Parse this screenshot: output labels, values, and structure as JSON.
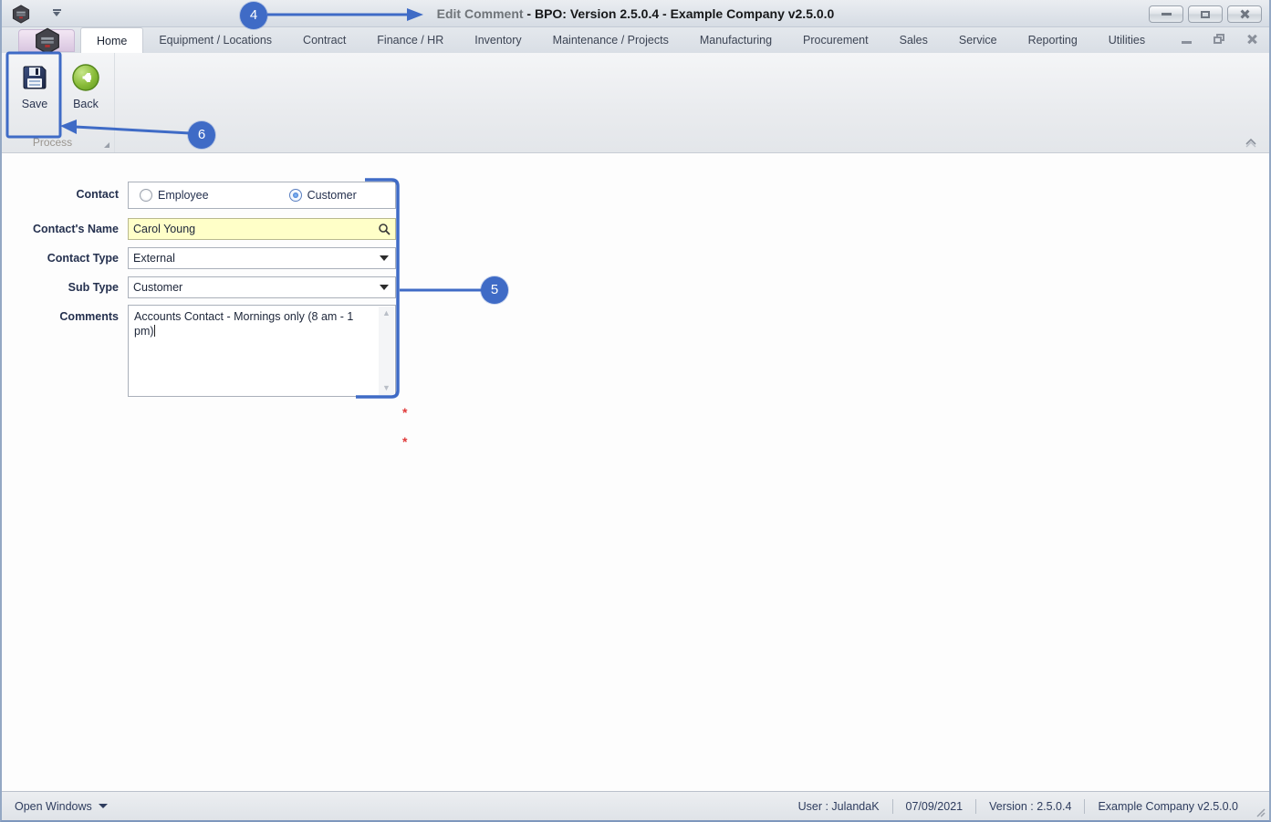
{
  "titlebar": {
    "title_prefix": "Edit Comment ",
    "title_main": "- BPO: Version 2.5.0.4 - Example Company v2.5.0.0"
  },
  "ribbon": {
    "tabs": [
      {
        "label": "Home",
        "selected": true
      },
      {
        "label": "Equipment / Locations",
        "selected": false
      },
      {
        "label": "Contract",
        "selected": false
      },
      {
        "label": "Finance / HR",
        "selected": false
      },
      {
        "label": "Inventory",
        "selected": false
      },
      {
        "label": "Maintenance / Projects",
        "selected": false
      },
      {
        "label": "Manufacturing",
        "selected": false
      },
      {
        "label": "Procurement",
        "selected": false
      },
      {
        "label": "Sales",
        "selected": false
      },
      {
        "label": "Service",
        "selected": false
      },
      {
        "label": "Reporting",
        "selected": false
      },
      {
        "label": "Utilities",
        "selected": false
      }
    ],
    "save_label": "Save",
    "back_label": "Back",
    "group_label": "Process"
  },
  "form": {
    "contact": {
      "label": "Contact",
      "options": [
        {
          "label": "Employee",
          "selected": false
        },
        {
          "label": "Customer",
          "selected": true
        }
      ]
    },
    "contacts_name": {
      "label": "Contact's Name",
      "value": "Carol Young"
    },
    "contact_type": {
      "label": "Contact Type",
      "value": "External",
      "required_marker": "*"
    },
    "sub_type": {
      "label": "Sub Type",
      "value": "Customer",
      "required_marker": "*"
    },
    "comments": {
      "label": "Comments",
      "value": "Accounts Contact - Mornings only (8 am - 1 pm)"
    }
  },
  "annotations": {
    "callout_4": "4",
    "callout_5": "5",
    "callout_6": "6"
  },
  "statusbar": {
    "open_windows": "Open Windows",
    "segments": [
      "User : JulandaK",
      "07/09/2021",
      "Version : 2.5.0.4",
      "Example Company v2.5.0.0"
    ]
  },
  "icons": {
    "scroll_up": "▲",
    "scroll_down": "▼"
  },
  "colors": {
    "annotation_blue": "#3f6bc6",
    "required_red": "#e03a3a",
    "field_highlight_yellow": "#ffffc8",
    "back_green": "#76b02e"
  }
}
